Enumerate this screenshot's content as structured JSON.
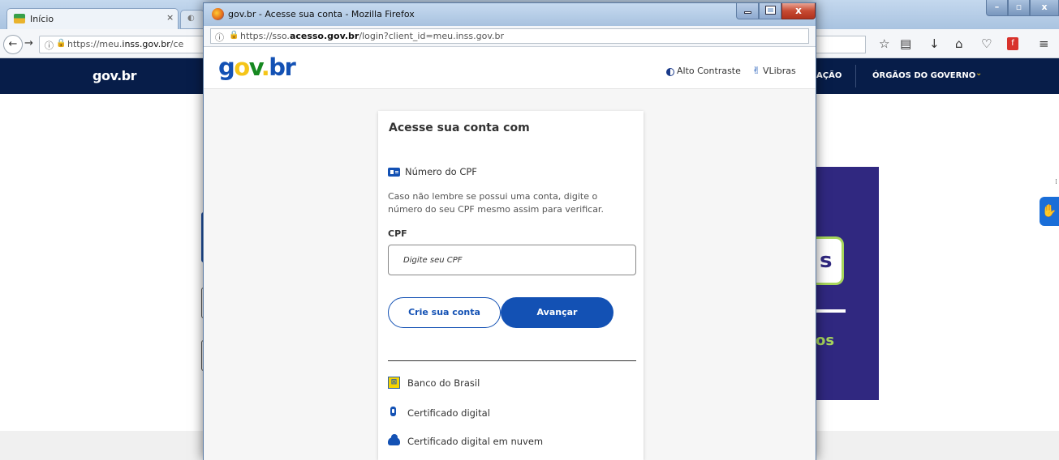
{
  "background_browser": {
    "tab_title": "Início",
    "tab_close": "×",
    "url_prefix": "https://meu.",
    "url_domain": "inss.gov.br",
    "url_suffix": "/ce",
    "navbar": {
      "logo": "gov.br",
      "item_partial": "AÇÃO",
      "item_orgaos": "ÓRGÃOS DO GOVERNO"
    },
    "panel_letter": "s",
    "panel_text": "os"
  },
  "popup": {
    "window_title": "gov.br - Acesse sua conta - Mozilla Firefox",
    "close_label": "x",
    "url_prefix": "https://sso.",
    "url_domain": "acesso.gov.br",
    "url_suffix": "/login?client_id=meu.inss.gov.br",
    "header": {
      "logo_parts": [
        "g",
        "o",
        "v",
        ".",
        "b",
        "r"
      ],
      "high_contrast": "Alto Contraste",
      "vlibras": "VLibras"
    },
    "card": {
      "title": "Acesse sua conta com",
      "cpf_heading": "Número do CPF",
      "cpf_help": "Caso não lembre se possui uma conta, digite o número do seu CPF mesmo assim para verificar.",
      "cpf_label": "CPF",
      "cpf_placeholder": "Digite seu CPF",
      "create_account": "Crie sua conta",
      "next": "Avançar",
      "alternatives": [
        {
          "label": "Banco do Brasil",
          "icon": "banco-do-brasil-icon"
        },
        {
          "label": "Certificado digital",
          "icon": "usb-token-icon"
        },
        {
          "label": "Certificado digital em nuvem",
          "icon": "cloud-icon"
        }
      ]
    }
  },
  "colors": {
    "navbar": "#071d49",
    "primary_blue": "#1351b4",
    "govbr_yellow": "#f5c518",
    "govbr_green": "#168821",
    "panel_purple": "#302880",
    "panel_accent": "#a7d65c"
  }
}
